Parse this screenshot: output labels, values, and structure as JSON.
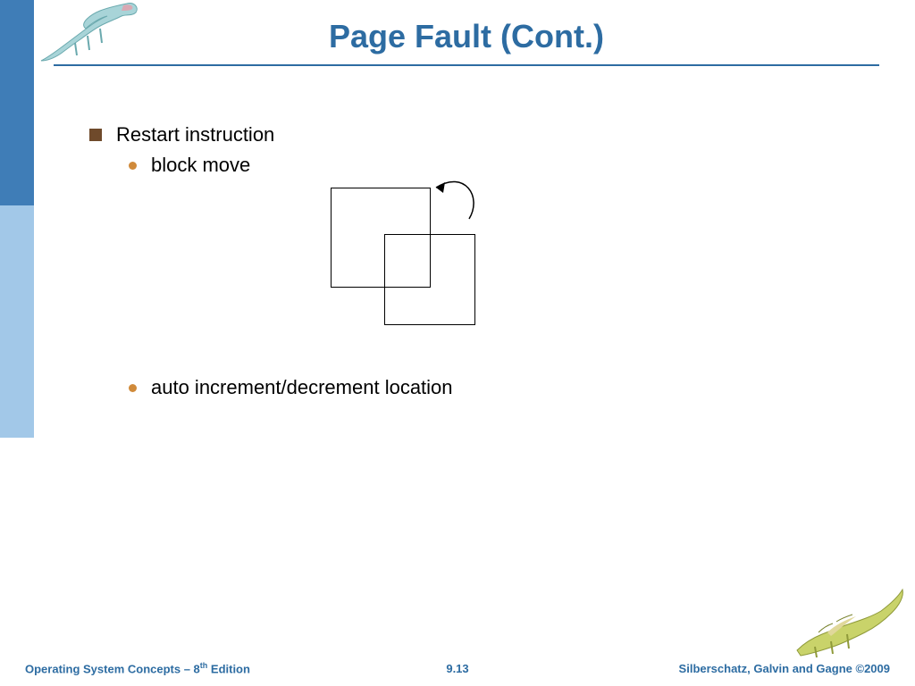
{
  "title": "Page Fault (Cont.)",
  "bullets": {
    "l1": "Restart instruction",
    "l2a": "block move",
    "l2b": "auto increment/decrement location"
  },
  "footer": {
    "left_prefix": "Operating System Concepts – 8",
    "left_suffix": " Edition",
    "left_sup": "th",
    "center": "9.13",
    "right": "Silberschatz, Galvin and Gagne ©2009"
  },
  "icons": {
    "dino_tl": "dinosaur-icon",
    "dino_br": "dinosaur-icon"
  }
}
